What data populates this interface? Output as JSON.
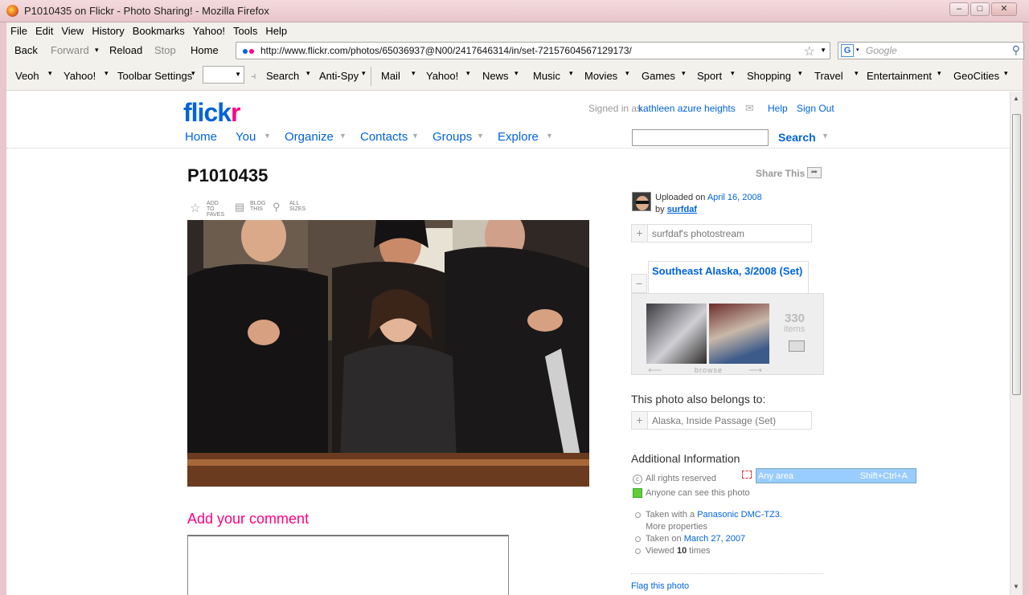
{
  "window": {
    "title": "P1010435 on Flickr - Photo Sharing! - Mozilla Firefox",
    "minimize": "–",
    "maximize": "□",
    "close": "✕"
  },
  "menubar": [
    "File",
    "Edit",
    "View",
    "History",
    "Bookmarks",
    "Yahoo!",
    "Tools",
    "Help"
  ],
  "nav": {
    "back": "Back",
    "forward": "Forward",
    "reload": "Reload",
    "stop": "Stop",
    "home": "Home",
    "url": "http://www.flickr.com/photos/65036937@N00/2417646314/in/set-72157604567129173/",
    "search_placeholder": "Google",
    "engine_letter": "G"
  },
  "toolbar2": {
    "items": [
      "Veoh",
      "Yahoo!",
      "Toolbar Settings",
      "Search",
      "Anti-Spy",
      "Mail",
      "Yahoo!",
      "News",
      "Music",
      "Movies",
      "Games",
      "Sport",
      "Shopping",
      "Travel",
      "Entertainment",
      "GeoCities"
    ]
  },
  "flickr": {
    "logo_a": "flick",
    "logo_b": "r",
    "signed_in_prefix": "Signed in as",
    "username": "kathleen azure heights",
    "help": "Help",
    "signout": "Sign Out",
    "nav": [
      "Home",
      "You",
      "Organize",
      "Contacts",
      "Groups",
      "Explore"
    ],
    "search_button": "Search"
  },
  "photo": {
    "title": "P1010435",
    "share": "Share This",
    "tools": [
      {
        "line1": "ADD TO",
        "line2": "FAVES"
      },
      {
        "line1": "BLOG",
        "line2": "THIS"
      },
      {
        "line1": "ALL",
        "line2": "SIZES"
      }
    ],
    "add_comment": "Add your comment"
  },
  "sidebar": {
    "uploaded_prefix": "Uploaded on",
    "uploaded_date": "April 16, 2008",
    "by_prefix": "by",
    "owner": "surfdaf",
    "photostream": "surfdaf's photostream",
    "set_title": "Southeast Alaska, 3/2008 (Set)",
    "set_count": "330",
    "set_count_label": "items",
    "browse": "browse",
    "belongs_heading": "This photo also belongs to:",
    "other_set": "Alaska, Inside Passage (Set)",
    "additional_heading": "Additional Information",
    "rights": "All rights reserved",
    "visibility": "Anyone can see this photo",
    "taken_with_prefix": "Taken with a",
    "camera": "Panasonic DMC-TZ3.",
    "more_properties": "More properties",
    "taken_on_prefix": "Taken on",
    "taken_date": "March 27, 2007",
    "viewed_prefix": "Viewed",
    "viewed_count": "10",
    "viewed_suffix": "times",
    "flag": "Flag this photo"
  },
  "popup": {
    "label": "Any area",
    "shortcut": "Shift+Ctrl+A"
  }
}
